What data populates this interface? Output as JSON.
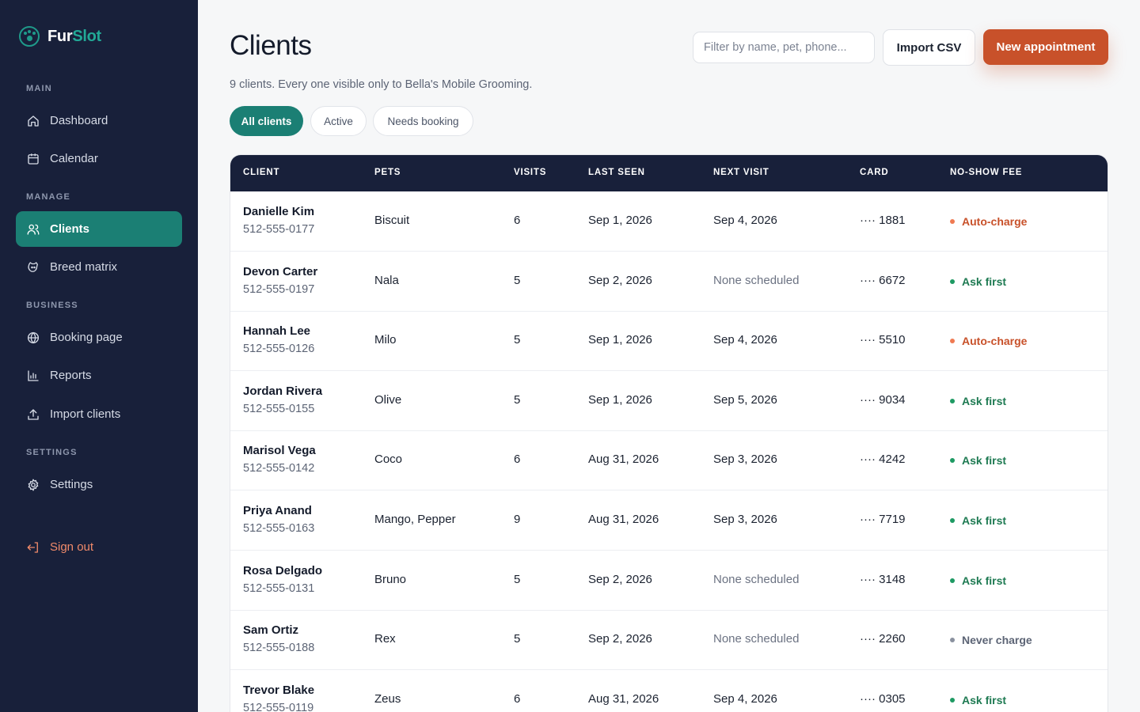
{
  "brand": {
    "name_a": "Fur",
    "name_b": "Slot"
  },
  "sidebar": {
    "sections": [
      "MAIN",
      "MANAGE",
      "BUSINESS",
      "SETTINGS"
    ],
    "items": [
      {
        "label": "Dashboard",
        "icon": "home-icon"
      },
      {
        "label": "Calendar",
        "icon": "calendar-icon"
      },
      {
        "label": "Clients",
        "icon": "users-icon",
        "active": true
      },
      {
        "label": "Breed matrix",
        "icon": "dog-icon"
      },
      {
        "label": "Booking page",
        "icon": "globe-icon"
      },
      {
        "label": "Reports",
        "icon": "bar-chart-icon"
      },
      {
        "label": "Import clients",
        "icon": "upload-icon"
      },
      {
        "label": "Settings",
        "icon": "gear-icon"
      }
    ],
    "sign_out": "Sign out"
  },
  "header": {
    "title": "Clients",
    "subtitle": "9 clients. Every one visible only to Bella's Mobile Grooming.",
    "filter_placeholder": "Filter by name, pet, phone...",
    "import_label": "Import CSV",
    "new_label": "New appointment"
  },
  "filters": [
    "All clients",
    "Active",
    "Needs booking"
  ],
  "table": {
    "columns": [
      "CLIENT",
      "PETS",
      "VISITS",
      "LAST SEEN",
      "NEXT VISIT",
      "CARD",
      "NO-SHOW FEE"
    ],
    "rows": [
      {
        "name": "Danielle Kim",
        "phone": "512-555-0177",
        "pets": "Biscuit",
        "visits": "6",
        "last": "Sep 1, 2026",
        "next": "Sep 4, 2026",
        "card": "···· 1881",
        "fee": "Auto-charge"
      },
      {
        "name": "Devon Carter",
        "phone": "512-555-0197",
        "pets": "Nala",
        "visits": "5",
        "last": "Sep 2, 2026",
        "next": "None scheduled",
        "card": "···· 6672",
        "fee": "Ask first"
      },
      {
        "name": "Hannah Lee",
        "phone": "512-555-0126",
        "pets": "Milo",
        "visits": "5",
        "last": "Sep 1, 2026",
        "next": "Sep 4, 2026",
        "card": "···· 5510",
        "fee": "Auto-charge"
      },
      {
        "name": "Jordan Rivera",
        "phone": "512-555-0155",
        "pets": "Olive",
        "visits": "5",
        "last": "Sep 1, 2026",
        "next": "Sep 5, 2026",
        "card": "···· 9034",
        "fee": "Ask first"
      },
      {
        "name": "Marisol Vega",
        "phone": "512-555-0142",
        "pets": "Coco",
        "visits": "6",
        "last": "Aug 31, 2026",
        "next": "Sep 3, 2026",
        "card": "···· 4242",
        "fee": "Ask first"
      },
      {
        "name": "Priya Anand",
        "phone": "512-555-0163",
        "pets": "Mango, Pepper",
        "visits": "9",
        "last": "Aug 31, 2026",
        "next": "Sep 3, 2026",
        "card": "···· 7719",
        "fee": "Ask first"
      },
      {
        "name": "Rosa Delgado",
        "phone": "512-555-0131",
        "pets": "Bruno",
        "visits": "5",
        "last": "Sep 2, 2026",
        "next": "None scheduled",
        "card": "···· 3148",
        "fee": "Ask first"
      },
      {
        "name": "Sam Ortiz",
        "phone": "512-555-0188",
        "pets": "Rex",
        "visits": "5",
        "last": "Sep 2, 2026",
        "next": "None scheduled",
        "card": "···· 2260",
        "fee": "Never charge"
      },
      {
        "name": "Trevor Blake",
        "phone": "512-555-0119",
        "pets": "Zeus",
        "visits": "6",
        "last": "Aug 31, 2026",
        "next": "Sep 4, 2026",
        "card": "···· 0305",
        "fee": "Ask first"
      }
    ]
  },
  "colors": {
    "sidebar_bg": "#18203a",
    "accent_teal": "#1b7f74",
    "cta_orange": "#c8512a",
    "auto_charge": "#c8512a",
    "ask_first": "#1e7a52",
    "never_charge": "#5c6475"
  }
}
